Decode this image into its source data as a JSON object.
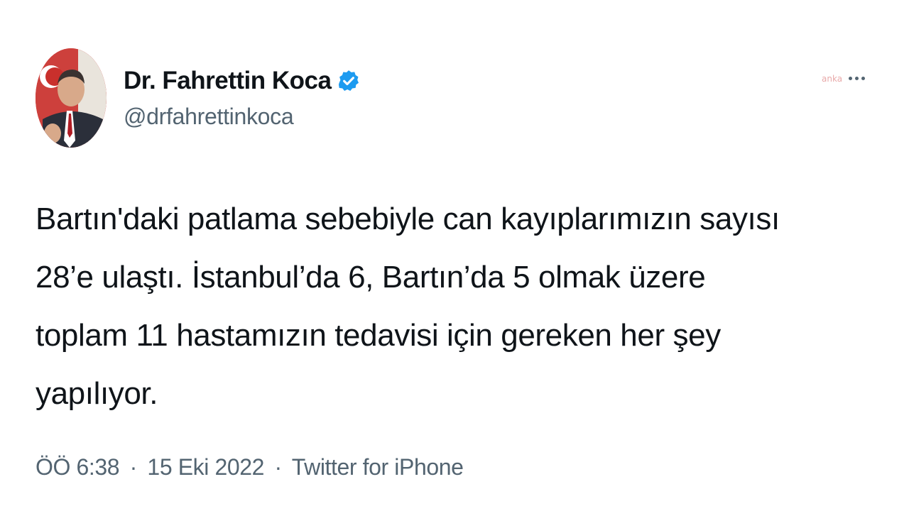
{
  "author": {
    "display_name": "Dr. Fahrettin Koca",
    "handle": "@drfahrettinkoca",
    "verified_icon": "verified-badge-icon",
    "accent_color": "#1d9bf0"
  },
  "more_icon": "more-horizontal-icon",
  "watermark_text": "anka",
  "tweet": {
    "lines": [
      "Bartın'daki patlama sebebiyle can kayıplarımızın sayısı",
      "28’e ulaştı. İstanbul’da 6, Bartın’da 5 olmak üzere",
      "toplam 11 hastamızın tedavisi için gereken her şey",
      "yapılıyor."
    ]
  },
  "meta": {
    "time": "ÖÖ 6:38",
    "separator": "·",
    "date": "15 Eki 2022",
    "source": "Twitter for iPhone"
  }
}
